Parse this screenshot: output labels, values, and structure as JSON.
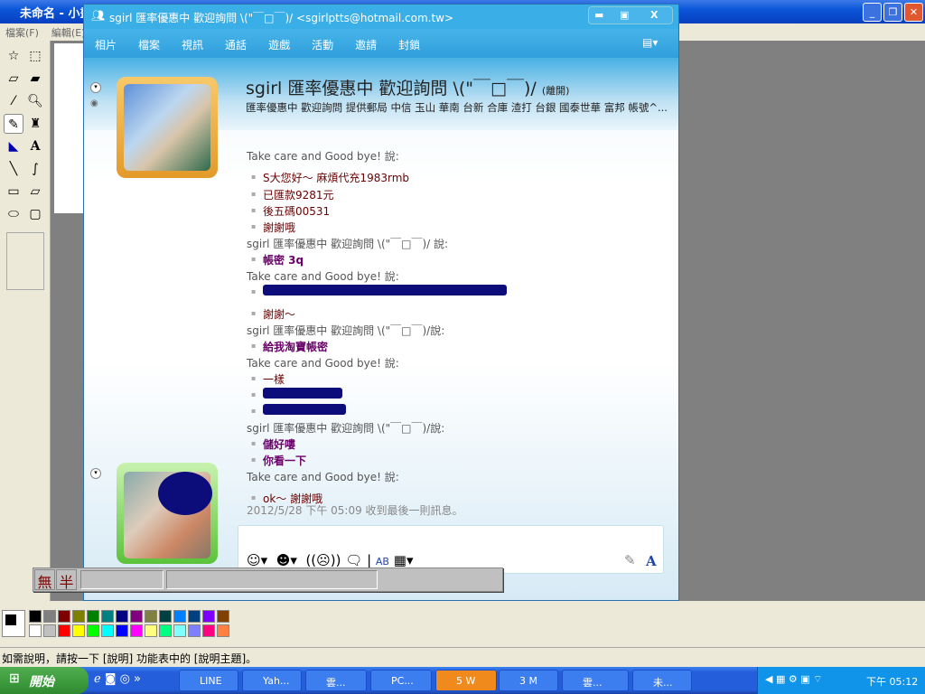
{
  "paint": {
    "title": "未命名 - 小畫家",
    "menu": [
      "檔案(F)",
      "編輯(E)"
    ],
    "status": "如需說明，請按一下 [說明] 功能表中的 [說明主題]。",
    "palette_top": [
      "#000000",
      "#808080",
      "#800000",
      "#808000",
      "#008000",
      "#008080",
      "#000080",
      "#800080",
      "#808040",
      "#004040",
      "#0080ff",
      "#004080",
      "#8000ff",
      "#804000"
    ],
    "palette_bottom": [
      "#ffffff",
      "#c0c0c0",
      "#ff0000",
      "#ffff00",
      "#00ff00",
      "#00ffff",
      "#0000ff",
      "#ff00ff",
      "#ffff80",
      "#00ff80",
      "#80ffff",
      "#8080ff",
      "#ff0080",
      "#ff8040"
    ]
  },
  "msn": {
    "title": "sgirl 匯率優惠中 歡迎詢問 \\(\"￣□￣)/ <sgirlptts@hotmail.com.tw>",
    "menu": [
      "相片",
      "檔案",
      "視訊",
      "通話",
      "遊戲",
      "活動",
      "邀請",
      "封鎖"
    ],
    "contact_name": "sgirl 匯率優惠中 歡迎詢問 \\(\"￣□￣)/",
    "contact_status": "(離開)",
    "contact_message": "匯率優惠中 歡迎詢問 提供郵局 中信 玉山 華南 台新 合庫 渣打 台銀 國泰世華 富邦 帳號^...",
    "messages": [
      {
        "type": "hdr",
        "text": "Take care and Good bye! 說:"
      },
      {
        "type": "item",
        "text": "S大您好〜 麻煩代充1983rmb"
      },
      {
        "type": "item",
        "text": "已匯款9281元"
      },
      {
        "type": "item",
        "text": "後五碼00531"
      },
      {
        "type": "item",
        "text": "謝謝哦"
      },
      {
        "type": "hdr",
        "text": "sgirl 匯率優惠中 歡迎詢問 \\(\"￣□￣)/ 說:"
      },
      {
        "type": "bold",
        "text": "帳密 3q"
      },
      {
        "type": "hdr",
        "text": "Take care and Good bye! 說:"
      },
      {
        "type": "red",
        "w": 270
      },
      {
        "type": "item",
        "text": "謝謝〜"
      },
      {
        "type": "hdr",
        "text": "sgirl 匯率優惠中 歡迎詢問 \\(\"￣□￣)/說:"
      },
      {
        "type": "bold",
        "text": "給我淘寶帳密"
      },
      {
        "type": "hdr",
        "text": "Take care and Good bye! 說:"
      },
      {
        "type": "item",
        "text": "一樣"
      },
      {
        "type": "red",
        "w": 88
      },
      {
        "type": "red",
        "w": 92
      },
      {
        "type": "hdr",
        "text": "sgirl 匯率優惠中 歡迎詢問 \\(\"￣□￣)/說:"
      },
      {
        "type": "bold",
        "text": "儲好嘍"
      },
      {
        "type": "bold",
        "text": "你看一下"
      },
      {
        "type": "hdr",
        "text": "Take care and Good bye! 說:"
      },
      {
        "type": "item",
        "text": "ok〜 謝謝哦"
      }
    ],
    "last_received": "2012/5/28 下午 05:09 收到最後一則訊息。",
    "ime": {
      "mode1": "無",
      "mode2": "半"
    }
  },
  "taskbar": {
    "start": "開始",
    "items": [
      "LINE",
      "Yah...",
      "雲...",
      "PC...",
      "5 W",
      "3 M",
      "雲...",
      "未..."
    ],
    "clock": "下午 05:12"
  }
}
